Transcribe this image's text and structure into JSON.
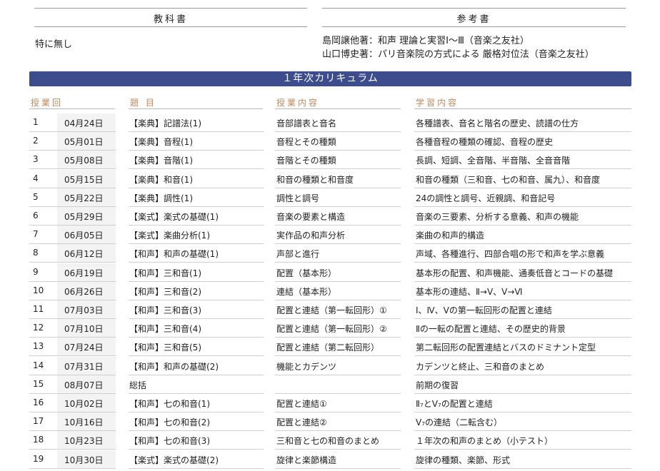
{
  "header": {
    "textbook_title": "教科書",
    "reference_title": "参考書",
    "textbook_value": "特に無し",
    "reference_lines": [
      "島岡譲他著：和声 理論と実習Ⅰ〜Ⅲ（音楽之友社）",
      "山口博史著：パリ音楽院の方式による 厳格対位法（音楽之友社）"
    ]
  },
  "banner": "１年次カリキュラム",
  "columns": {
    "session": "授業回",
    "topic": "題 目",
    "content": "授業内容",
    "learning": "学習内容"
  },
  "rows": [
    {
      "no": "1",
      "date": "04月24日",
      "topic": "【楽典】記譜法(1)",
      "content": "音部譜表と音名",
      "learning": "各種譜表、音名と階名の歴史、読譜の仕方"
    },
    {
      "no": "2",
      "date": "05月01日",
      "topic": "【楽典】音程(1)",
      "content": "音程とその種類",
      "learning": "各種音程の種類の確認、音程の歴史"
    },
    {
      "no": "3",
      "date": "05月08日",
      "topic": "【楽典】音階(1)",
      "content": "音階とその種類",
      "learning": "長調、短調、全音階、半音階、全音音階"
    },
    {
      "no": "4",
      "date": "05月15日",
      "topic": "【楽典】和音(1)",
      "content": "和音の種類と和音度",
      "learning": "和音の種類（三和音、七の和音、属九）、和音度"
    },
    {
      "no": "5",
      "date": "05月22日",
      "topic": "【楽典】調性(1)",
      "content": "調性と調号",
      "learning": "24の調性と調号、近親調、和音記号"
    },
    {
      "no": "6",
      "date": "05月29日",
      "topic": "【楽式】楽式の基礎(1)",
      "content": "音楽の要素と構造",
      "learning": "音楽の三要素、分析する意義、和声の機能"
    },
    {
      "no": "7",
      "date": "06月05日",
      "topic": "【楽式】楽曲分析(1)",
      "content": "実作品の和声分析",
      "learning": "楽曲の和声的構造"
    },
    {
      "no": "8",
      "date": "06月12日",
      "topic": "【和声】和声の基礎(1)",
      "content": "声部と進行",
      "learning": "声域、各種進行、四部合唱の形で和声を学ぶ意義"
    },
    {
      "no": "9",
      "date": "06月19日",
      "topic": "【和声】三和音(1)",
      "content": "配置（基本形）",
      "learning": "基本形の配置、和声機能、通奏低音とコードの基礎"
    },
    {
      "no": "10",
      "date": "06月26日",
      "topic": "【和声】三和音(2)",
      "content": "連結（基本形）",
      "learning": "基本形の連結、Ⅱ→Ⅴ、Ⅴ→Ⅵ"
    },
    {
      "no": "11",
      "date": "07月03日",
      "topic": "【和声】三和音(3)",
      "content": "配置と連結（第一転回形）①",
      "learning": "Ⅰ、Ⅳ、Ⅴの第一転回形の配置と連結"
    },
    {
      "no": "12",
      "date": "07月10日",
      "topic": "【和声】三和音(4)",
      "content": "配置と連結（第一転回形）②",
      "learning": "Ⅱの一転の配置と連結、その歴史的背景"
    },
    {
      "no": "13",
      "date": "07月24日",
      "topic": "【和声】三和音(5)",
      "content": "配置と連結（第二転回形）",
      "learning": "第二転回形の配置連結とバスのドミナント定型"
    },
    {
      "no": "14",
      "date": "07月31日",
      "topic": "【和声】和声の基礎(2)",
      "content": "機能とカデンツ",
      "learning": "カデンツと終止、三和音のまとめ"
    },
    {
      "no": "15",
      "date": "08月07日",
      "topic": "総括",
      "content": "",
      "learning": "前期の復習"
    },
    {
      "no": "16",
      "date": "10月02日",
      "topic": "【和声】七の和音(1)",
      "content": "配置と連結①",
      "learning": "Ⅱ₇とⅤ₇の配置と連結"
    },
    {
      "no": "17",
      "date": "10月16日",
      "topic": "【和声】七の和音(2)",
      "content": "配置と連結②",
      "learning": "Ⅴ₇の連結（二転含む）"
    },
    {
      "no": "18",
      "date": "10月23日",
      "topic": "【和声】七の和音(3)",
      "content": "三和音と七の和音のまとめ",
      "learning": "１年次の和声のまとめ（小テスト）"
    },
    {
      "no": "19",
      "date": "10月30日",
      "topic": "【楽式】楽式の基礎(2)",
      "content": "旋律と楽節構造",
      "learning": "旋律の種類、楽節、形式"
    }
  ]
}
